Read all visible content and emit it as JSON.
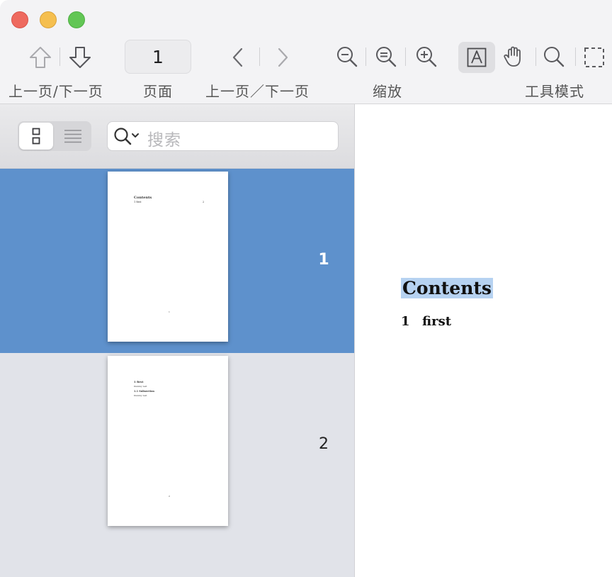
{
  "toolbar": {
    "page_number": "1",
    "labels": {
      "prev_next_page": "上一页/下一页",
      "page": "页面",
      "prev_next": "上一页／下一页",
      "zoom": "缩放",
      "tool_mode": "工具模式"
    },
    "icons": [
      "arrow-up-icon",
      "arrow-down-icon",
      "chevron-left-icon",
      "chevron-right-icon",
      "zoom-out-icon",
      "zoom-fit-icon",
      "zoom-in-icon",
      "text-select-icon",
      "hand-icon",
      "magnifier-icon",
      "selection-icon"
    ],
    "active_tool": "text-select"
  },
  "sidebar": {
    "search_placeholder": "搜索",
    "view_mode": "thumbnails",
    "pages": [
      {
        "number": "1",
        "selected": true,
        "mini": {
          "heading": "Contents",
          "toc_entry": "1 first",
          "toc_page": "2",
          "footer": "1"
        }
      },
      {
        "number": "2",
        "selected": false,
        "mini": {
          "section": "1 first",
          "body1": "Dummy text",
          "subsection": "1.1 Subsection",
          "body2": "Dummy text",
          "footer": "2"
        }
      }
    ]
  },
  "document": {
    "heading": "Contents",
    "toc": [
      {
        "num": "1",
        "title": "first"
      }
    ]
  },
  "colors": {
    "selected_row": "#5e91cc",
    "sidebar_bg": "#e1e3e9",
    "text_highlight": "#b6d2f1",
    "close": "#ee6a5f",
    "minimize": "#f5bf4f",
    "maximize": "#62c655"
  }
}
